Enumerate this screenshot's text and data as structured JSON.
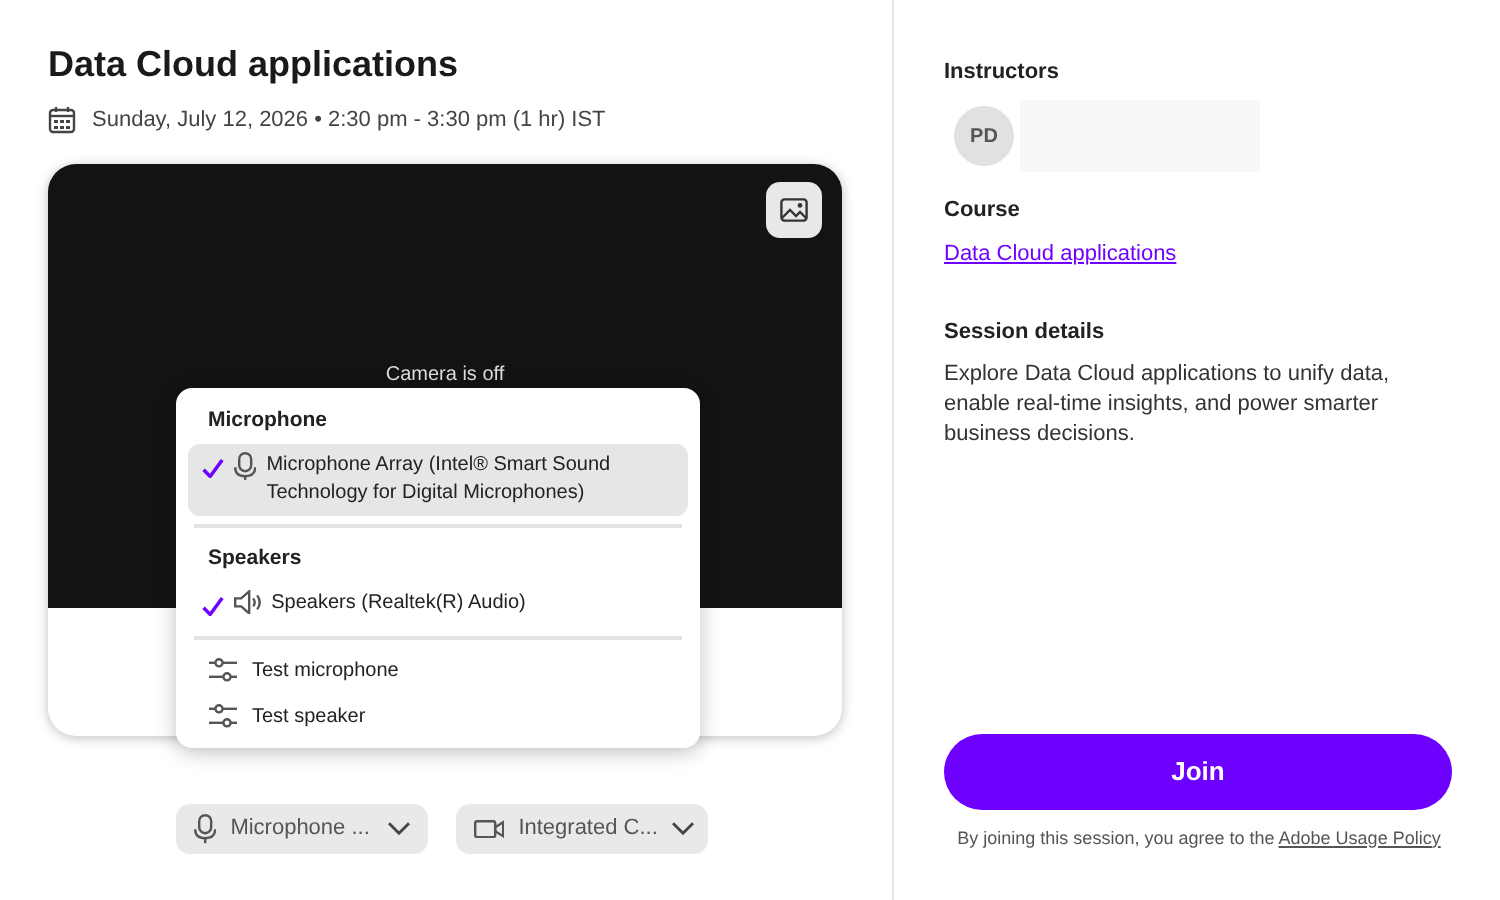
{
  "title": "Data Cloud applications",
  "schedule": "Sunday, July 12, 2026 • 2:30 pm - 3:30 pm (1 hr) IST",
  "preview": {
    "camera_status": "Camera is off"
  },
  "device_menu": {
    "sections": [
      {
        "heading": "Microphone",
        "items": [
          {
            "kind": "microphone",
            "label": "Microphone Array (Intel® Smart Sound Technology for Digital Microphones)",
            "selected": true,
            "hovered": true
          }
        ]
      },
      {
        "heading": "Speakers",
        "items": [
          {
            "kind": "speaker",
            "label": "Speakers (Realtek(R) Audio)",
            "selected": true,
            "hovered": false
          }
        ]
      }
    ],
    "actions": [
      {
        "label": "Test microphone"
      },
      {
        "label": "Test speaker"
      }
    ]
  },
  "device_buttons": [
    {
      "kind": "microphone",
      "label": "Microphone ..."
    },
    {
      "kind": "camera",
      "label": "Integrated C..."
    }
  ],
  "sidebar": {
    "instructors_heading": "Instructors",
    "instructors": [
      {
        "initials": "PD"
      }
    ],
    "course_heading": "Course",
    "course_link": "Data Cloud applications",
    "details_heading": "Session details",
    "details": "Explore Data Cloud applications to unify data, enable real-time insights, and power smarter business decisions.",
    "join_button": "Join",
    "agreement": "By joining this session, you agree to the",
    "policy_link": "Adobe Usage Policy"
  }
}
